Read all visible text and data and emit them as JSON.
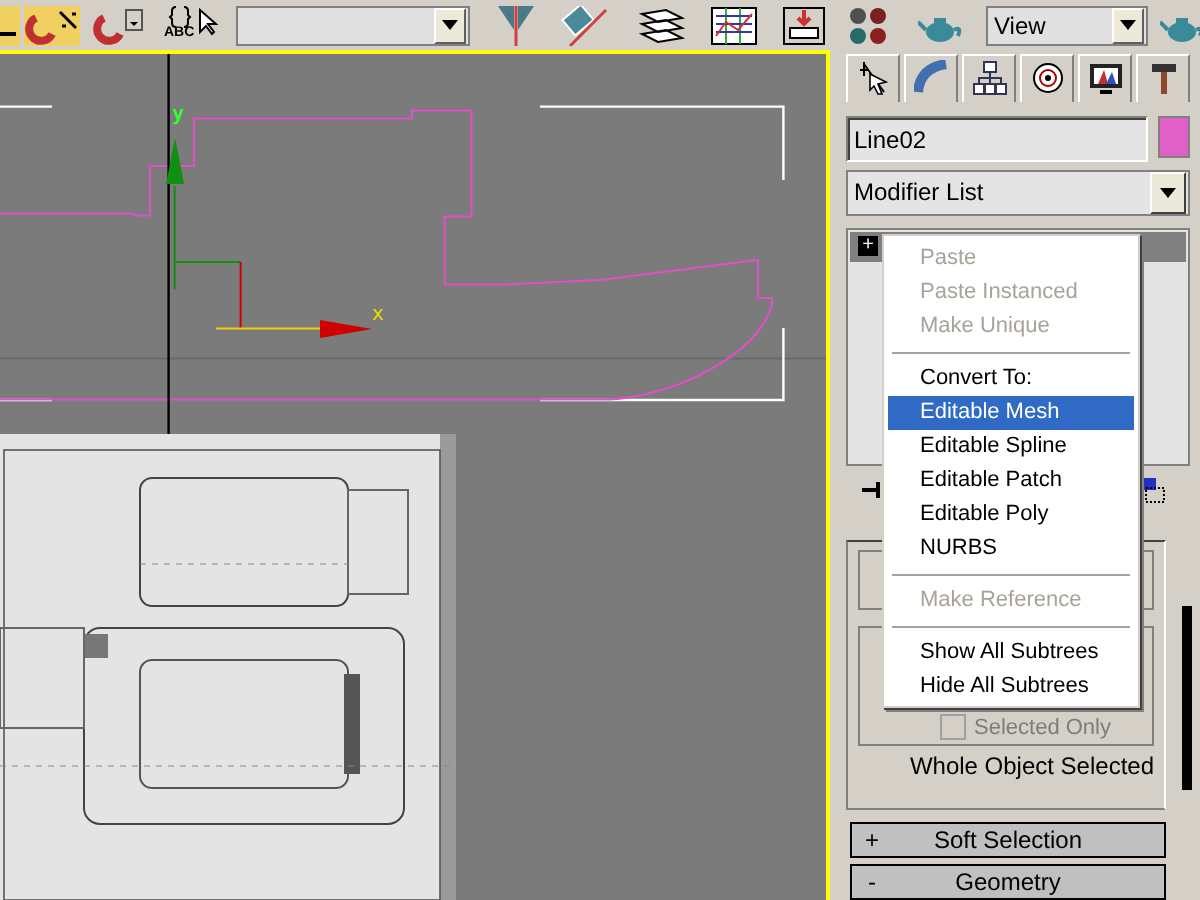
{
  "toolbar": {
    "abc_label": "ABC",
    "view_dropdown": "View"
  },
  "viewport": {
    "active": true,
    "gizmo": {
      "y_label": "y",
      "x_label": "x"
    }
  },
  "command_panel": {
    "object": {
      "name": "Line02",
      "color": "#e060c8"
    },
    "modifier_list": "Modifier List",
    "stack": [
      {
        "expander": "+",
        "selected": true
      }
    ],
    "context_menu": [
      {
        "kind": "item",
        "label": "Paste",
        "disabled": true,
        "selected": false
      },
      {
        "kind": "item",
        "label": "Paste Instanced",
        "disabled": true,
        "selected": false
      },
      {
        "kind": "item",
        "label": "Make Unique",
        "disabled": true,
        "selected": false
      },
      {
        "kind": "separator"
      },
      {
        "kind": "item",
        "label": "Convert To:",
        "disabled": false,
        "selected": false
      },
      {
        "kind": "item",
        "label": "Editable Mesh",
        "disabled": false,
        "selected": true
      },
      {
        "kind": "item",
        "label": "Editable Spline",
        "disabled": false,
        "selected": false
      },
      {
        "kind": "item",
        "label": "Editable Patch",
        "disabled": false,
        "selected": false
      },
      {
        "kind": "item",
        "label": "Editable Poly",
        "disabled": false,
        "selected": false
      },
      {
        "kind": "item",
        "label": "NURBS",
        "disabled": false,
        "selected": false
      },
      {
        "kind": "separator"
      },
      {
        "kind": "item",
        "label": "Make Reference",
        "disabled": true,
        "selected": false
      },
      {
        "kind": "separator"
      },
      {
        "kind": "item",
        "label": "Show All Subtrees",
        "disabled": false,
        "selected": false
      },
      {
        "kind": "item",
        "label": "Hide All Subtrees",
        "disabled": false,
        "selected": false
      }
    ],
    "selection": {
      "selected_only": {
        "label": "Selected Only",
        "checked": false,
        "disabled": true
      },
      "status": "Whole Object Selected"
    },
    "rollouts": [
      {
        "toggle": "+",
        "title": "Soft Selection"
      },
      {
        "toggle": "-",
        "title": "Geometry"
      }
    ]
  }
}
